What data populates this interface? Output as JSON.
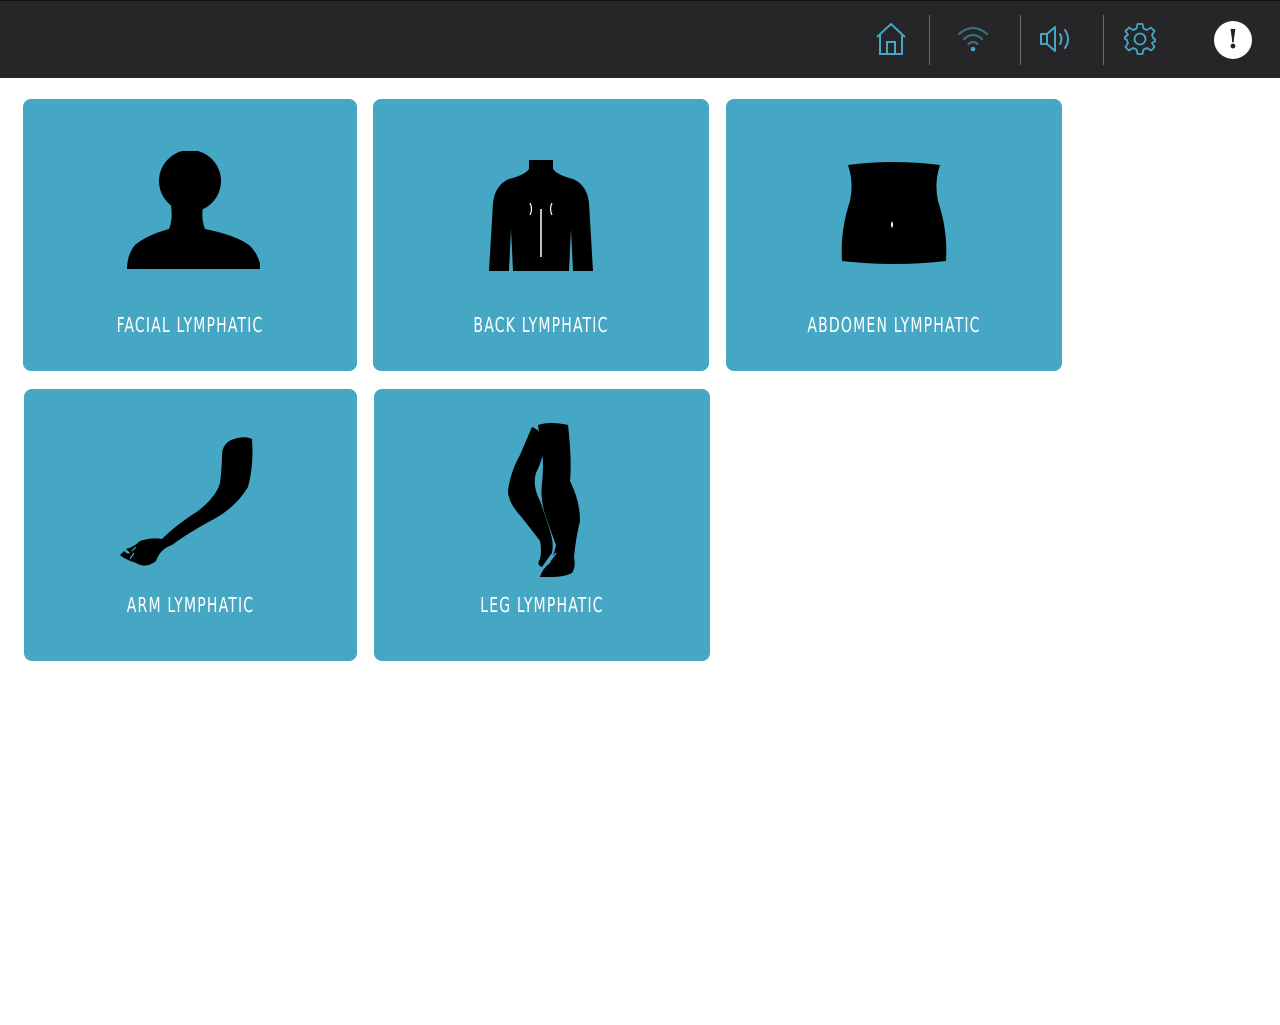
{
  "topbar": {
    "icons": [
      "home-icon",
      "wifi-icon",
      "speaker-icon",
      "gear-icon",
      "alert-icon"
    ],
    "accent_color": "#45a7c3",
    "alert_symbol": "!"
  },
  "tiles": [
    {
      "label": "FACIAL LYMPHATIC",
      "icon": "head-silhouette-icon"
    },
    {
      "label": "BACK LYMPHATIC",
      "icon": "back-silhouette-icon"
    },
    {
      "label": "ABDOMEN LYMPHATIC",
      "icon": "abdomen-silhouette-icon"
    },
    {
      "label": "ARM LYMPHATIC",
      "icon": "arm-silhouette-icon"
    },
    {
      "label": "LEG LYMPHATIC",
      "icon": "leg-silhouette-icon"
    }
  ],
  "colors": {
    "header_bg": "#262527",
    "tile_bg": "#45a7c3",
    "tile_text": "#ffffff"
  }
}
